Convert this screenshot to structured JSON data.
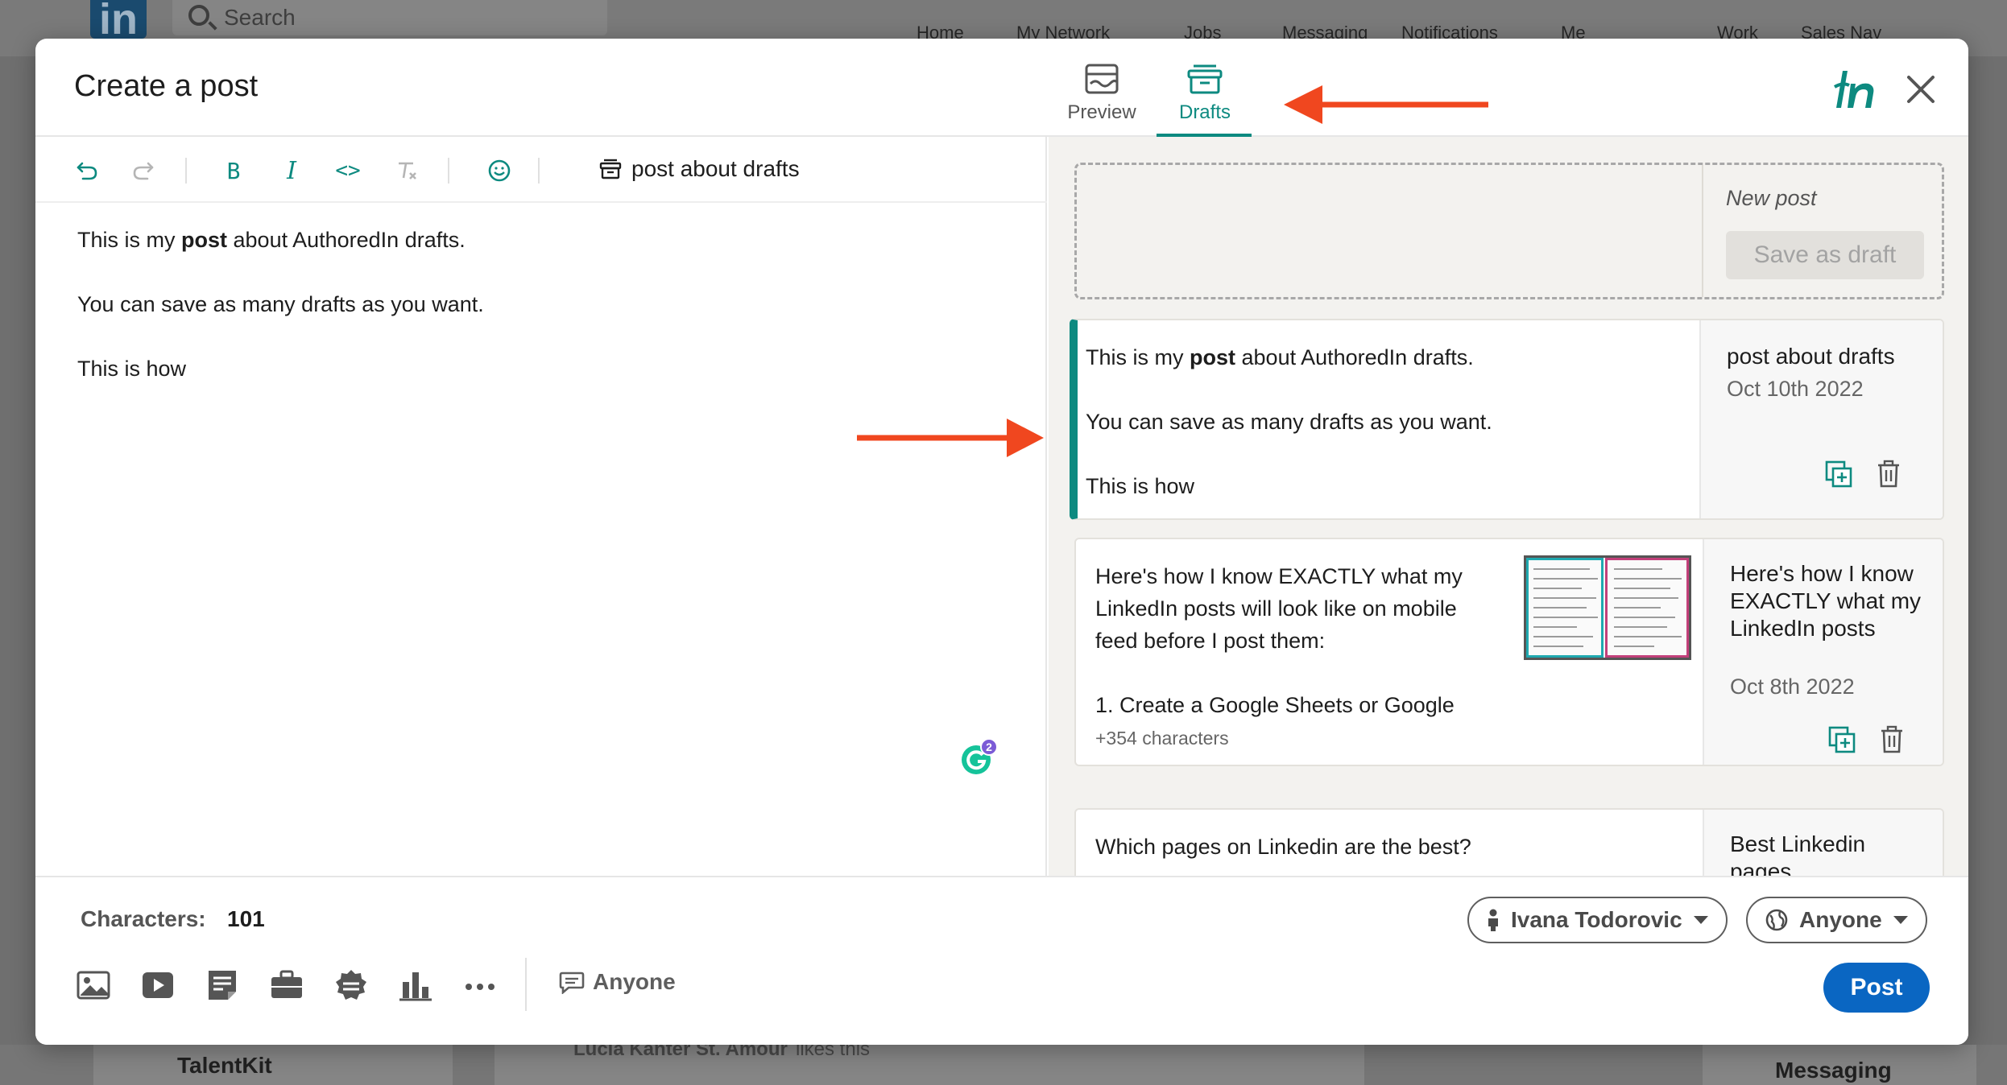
{
  "background": {
    "logo": "in",
    "search_placeholder": "Search",
    "nav": [
      "Home",
      "My Network",
      "Jobs",
      "Messaging",
      "Notifications",
      "Me",
      "Work",
      "Sales Nav"
    ],
    "bottom_company": "TalentKit",
    "bottom_activity_name": "Lucia Kanter St. Amour",
    "bottom_activity_action": "likes this",
    "bottom_messaging": "Messaging"
  },
  "modal": {
    "title": "Create a post",
    "tabs": [
      {
        "label": "Preview",
        "icon": "preview-icon",
        "active": false
      },
      {
        "label": "Drafts",
        "icon": "drafts-icon",
        "active": true
      }
    ],
    "brand_icon": "authoredin-icon",
    "close_icon": "close-icon"
  },
  "toolbar": {
    "buttons": [
      "undo-icon",
      "redo-icon",
      "bold-icon",
      "italic-icon",
      "code-icon",
      "clear-format-icon",
      "emoji-icon"
    ],
    "bold_glyph": "B",
    "italic_glyph": "I",
    "code_glyph": "<>",
    "draft_name": "post about drafts"
  },
  "editor": {
    "line1_before": "This is my ",
    "line1_bold": "post",
    "line1_after": " about AuthoredIn drafts.",
    "line2": "You can save as many drafts as you want.",
    "line3": "This is how",
    "grammarly_badge": "2"
  },
  "drafts": {
    "new_post_label": "New post",
    "save_draft_label": "Save as draft",
    "items": [
      {
        "line1_before": "This is my ",
        "line1_bold": "post",
        "line1_after": " about AuthoredIn drafts.",
        "line2": "You can save as many drafts as you want.",
        "line3": "This is how",
        "title": "post about drafts",
        "date": "Oct 10th 2022",
        "selected": true
      },
      {
        "line1": "Here's how I know EXACTLY what my",
        "line2": "LinkedIn posts will look like on mobile",
        "line3": "feed before I post them:",
        "line4": "1. Create a Google Sheets or Google",
        "more": "+354 characters",
        "title": "Here's how I know EXACTLY what my LinkedIn posts",
        "date": "Oct 8th 2022",
        "selected": false
      },
      {
        "line1": "Which pages on Linkedin are the best?",
        "title": "Best Linkedin pages",
        "selected": false
      }
    ]
  },
  "footer": {
    "characters_label": "Characters:",
    "characters_value": "101",
    "author_label": "Ivana Todorovic",
    "visibility_label": "Anyone",
    "comment_visibility_label": "Anyone",
    "post_label": "Post",
    "icons": [
      "photo-icon",
      "video-icon",
      "document-icon",
      "job-icon",
      "badge-icon",
      "poll-icon",
      "more-icon"
    ]
  },
  "colors": {
    "accent": "#0d8a80",
    "post_button": "#0a66c2",
    "arrow": "#f0471f"
  }
}
